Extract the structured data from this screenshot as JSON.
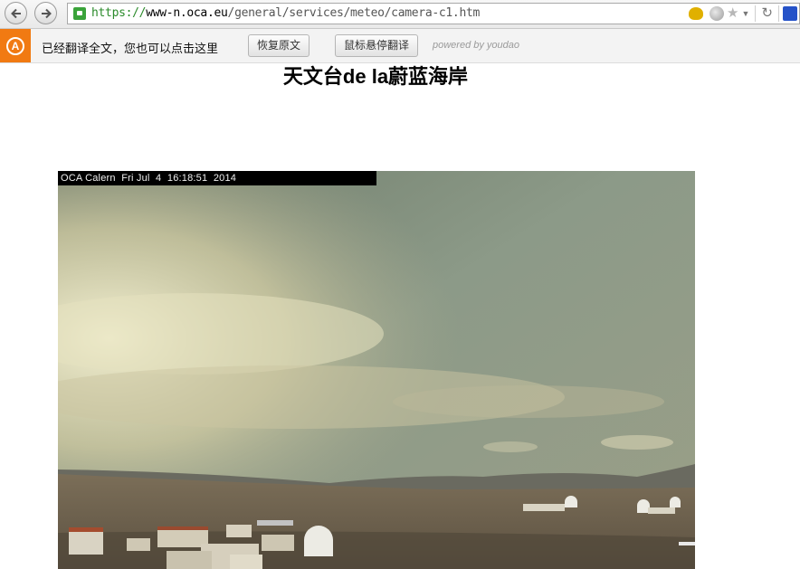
{
  "browser": {
    "url_scheme": "https://",
    "url_host": "www-n.oca.eu",
    "url_path": "/general/services/meteo/camera-c1.htm",
    "icons": [
      "back-arrow-icon",
      "forward-arrow-icon",
      "lock-icon",
      "extension-duck-icon",
      "globe-icon",
      "star-icon",
      "dropdown-icon",
      "reload-icon",
      "paw-icon"
    ]
  },
  "translate_bar": {
    "message": "已经翻译全文，您也可以点击这里",
    "restore_label": "恢复原文",
    "hover_label": "鼠标悬停翻译",
    "powered_by": "powered by youdao",
    "badge_letter": "A",
    "accent": "#f17a12"
  },
  "page": {
    "title": "天文台de la蔚蓝海岸",
    "camera_caption": "OCA Calern  Fri Jul  4  16:18:51  2014"
  }
}
